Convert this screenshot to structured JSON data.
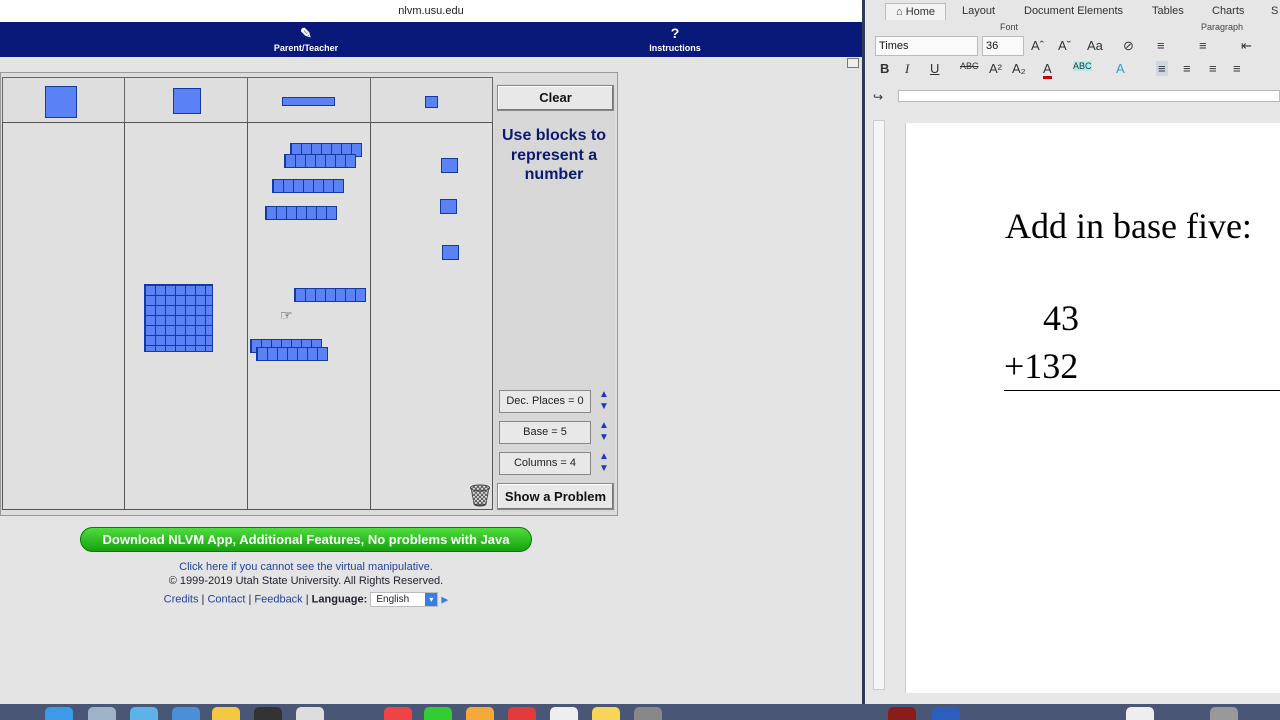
{
  "browser": {
    "url": "nlvm.usu.edu",
    "nav": {
      "parent_teacher": "Parent/Teacher",
      "instructions": "Instructions"
    }
  },
  "applet": {
    "clear_label": "Clear",
    "instruction": "Use blocks to represent a number",
    "settings": {
      "dec_places": "Dec. Places = 0",
      "base": "Base = 5",
      "columns": "Columns = 4"
    },
    "show_problem_label": "Show a Problem"
  },
  "footer": {
    "download_label": "Download NLVM App, Additional Features, No problems with Java",
    "cannot_see": "Click here if you cannot see the virtual manipulative.",
    "copyright": "© 1999-2019 Utah State University. All Rights Reserved.",
    "credits": "Credits",
    "contact": "Contact",
    "feedback": "Feedback",
    "language_label": "Language:",
    "language_value": "English"
  },
  "word": {
    "tabs": [
      "Home",
      "Layout",
      "Document Elements",
      "Tables",
      "Charts",
      "S"
    ],
    "font_group": "Font",
    "paragraph_group": "Paragraph",
    "font_name": "Times",
    "font_size": "36",
    "document": {
      "title": "Add in base five:",
      "line1": "43",
      "line2": "+132"
    }
  }
}
